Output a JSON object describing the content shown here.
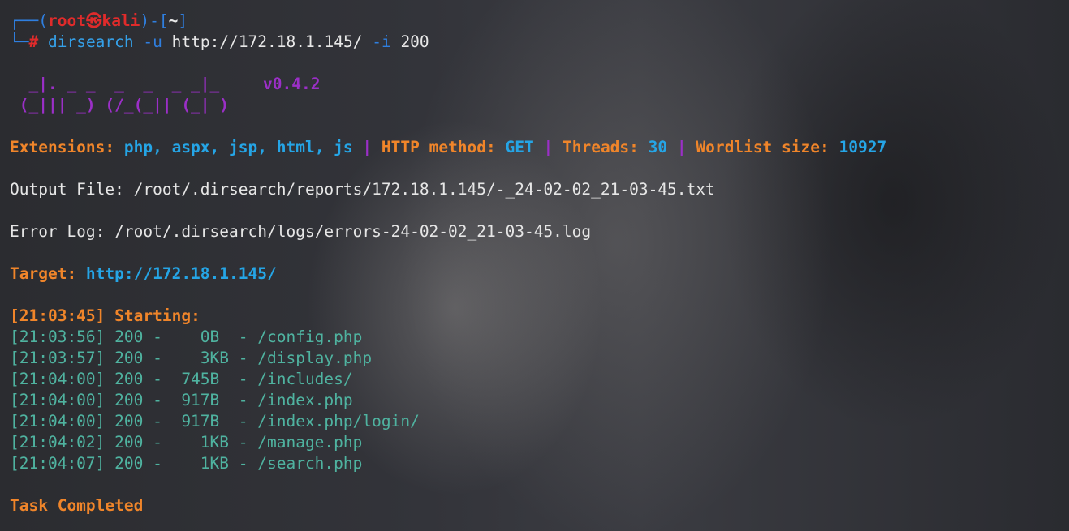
{
  "prompt": {
    "corner_top": "┌──(",
    "user": "root",
    "at_symbol": "㉿",
    "host": "kali",
    "dir_open": ")-[",
    "dir": "~",
    "dir_close": "]",
    "corner_bottom": "└─",
    "hash": "#",
    "cmd": "dirsearch",
    "flag_u": "-u",
    "url": "http://172.18.1.145/",
    "flag_i": "-i",
    "status_filter": "200"
  },
  "banner": {
    "line1": "  _|. _ _  _  _  _ _|_",
    "line2": " (_||| _) (/_(_|| (_| )",
    "version": "v0.4.2"
  },
  "config": {
    "ext_label": "Extensions: ",
    "ext_value": "php, aspx, jsp, html, js",
    "sep1": " | ",
    "method_label": "HTTP method: ",
    "method_value": "GET",
    "sep2": " | ",
    "threads_label": "Threads: ",
    "threads_value": "30",
    "sep3": " | ",
    "wordlist_label": "Wordlist size: ",
    "wordlist_value": "10927"
  },
  "output_file": "Output File: /root/.dirsearch/reports/172.18.1.145/-_24-02-02_21-03-45.txt",
  "error_log": "Error Log: /root/.dirsearch/logs/errors-24-02-02_21-03-45.log",
  "target": {
    "label": "Target: ",
    "url": "http://172.18.1.145/"
  },
  "starting": {
    "time": "[21:03:45]",
    "label": " Starting:"
  },
  "results": [
    "[21:03:56] 200 -    0B  - /config.php",
    "[21:03:57] 200 -    3KB - /display.php",
    "[21:04:00] 200 -  745B  - /includes/",
    "[21:04:00] 200 -  917B  - /index.php",
    "[21:04:00] 200 -  917B  - /index.php/login/",
    "[21:04:02] 200 -    1KB - /manage.php",
    "[21:04:07] 200 -    1KB - /search.php"
  ],
  "done": "Task Completed"
}
